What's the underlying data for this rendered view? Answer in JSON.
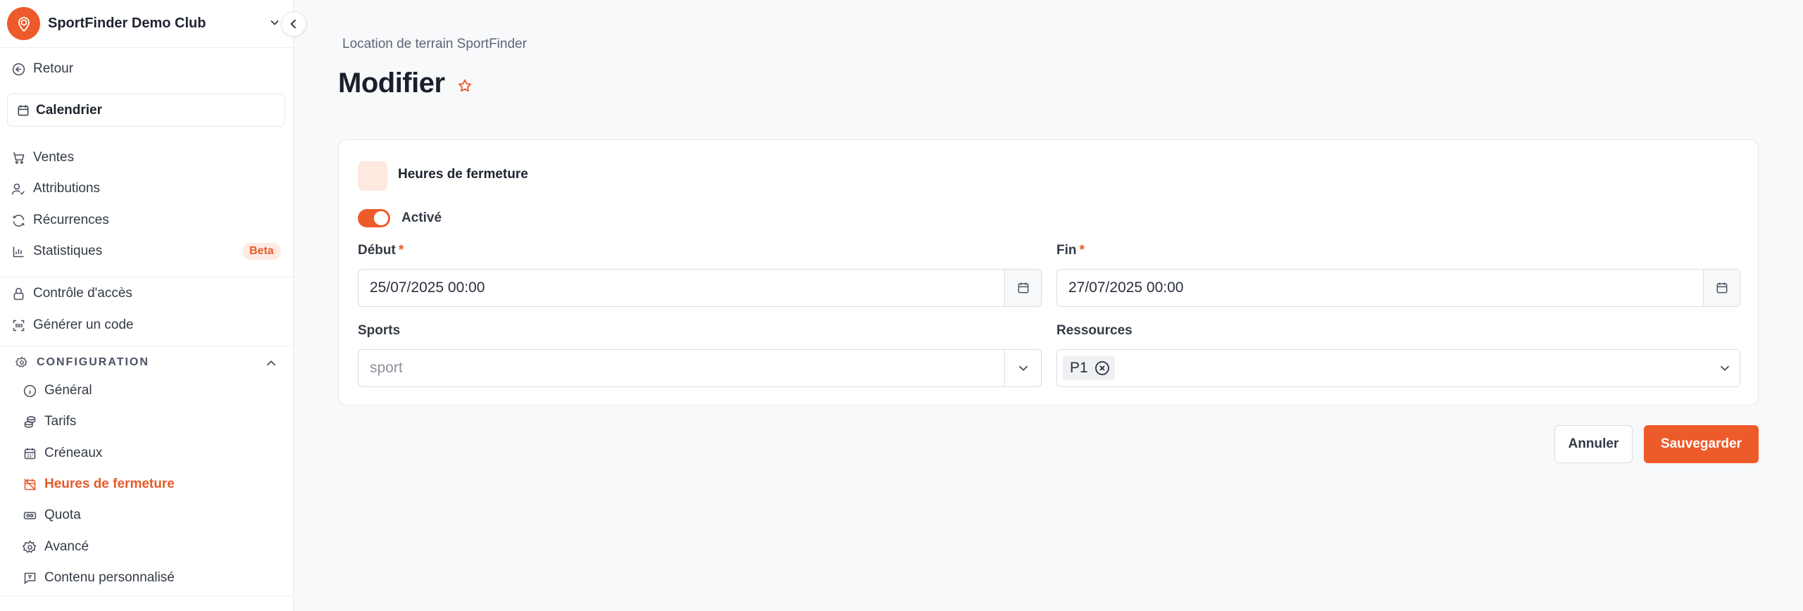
{
  "sidebar": {
    "club_name": "SportFinder Demo Club",
    "back_label": "Retour",
    "calendar_label": "Calendrier",
    "menu": [
      {
        "label": "Ventes"
      },
      {
        "label": "Attributions"
      },
      {
        "label": "Récurrences"
      },
      {
        "label": "Statistiques",
        "badge": "Beta"
      }
    ],
    "tools": [
      {
        "label": "Contrôle d'accès"
      },
      {
        "label": "Générer un code"
      }
    ],
    "config_title": "CONFIGURATION",
    "config_items": [
      {
        "label": "Général"
      },
      {
        "label": "Tarifs"
      },
      {
        "label": "Créneaux"
      },
      {
        "label": "Heures de fermeture",
        "active": true
      },
      {
        "label": "Quota"
      },
      {
        "label": "Avancé"
      },
      {
        "label": "Contenu personnalisé"
      }
    ]
  },
  "main": {
    "breadcrumb": "Location de terrain SportFinder",
    "title": "Modifier",
    "card": {
      "title": "Heures de fermeture",
      "toggle_label": "Activé",
      "toggle_on": true,
      "start_label": "Début",
      "start_value": "25/07/2025 00:00",
      "end_label": "Fin",
      "end_value": "27/07/2025 00:00",
      "required_mark": "*",
      "sports_label": "Sports",
      "sports_placeholder": "sport",
      "resources_label": "Ressources",
      "resources_selected": [
        "P1"
      ]
    },
    "actions": {
      "cancel": "Annuler",
      "save": "Sauvegarder"
    }
  },
  "colors": {
    "accent": "#ee5b2a",
    "accent_light": "#fde9df",
    "background": "#f8f9fb"
  }
}
